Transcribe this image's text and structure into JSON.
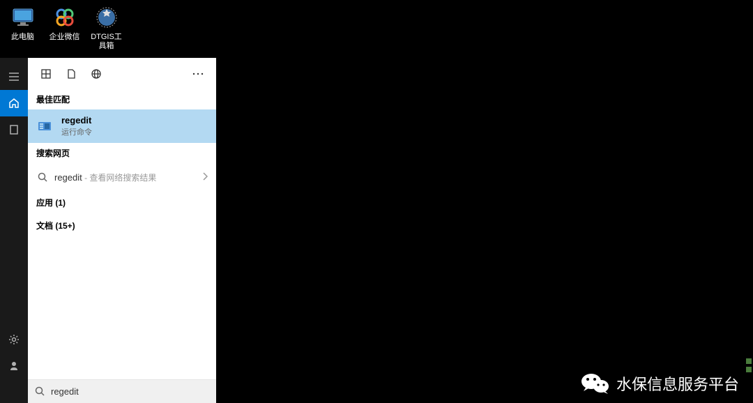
{
  "desktop": {
    "icons": [
      {
        "label": "此电脑",
        "name": "this-pc"
      },
      {
        "label": "企业微信",
        "name": "wecom"
      },
      {
        "label": "DTGIS工具箱",
        "name": "dtgis-toolbox"
      }
    ]
  },
  "search": {
    "sections": {
      "best_match": "最佳匹配",
      "web": "搜索网页",
      "apps": "应用 (1)",
      "docs": "文档 (15+)"
    },
    "best_match_result": {
      "title": "regedit",
      "subtitle": "运行命令"
    },
    "web_result": {
      "query": "regedit",
      "hint": " - 查看网络搜索结果"
    },
    "input_value": "regedit"
  },
  "watermark": {
    "text": "水保信息服务平台"
  }
}
